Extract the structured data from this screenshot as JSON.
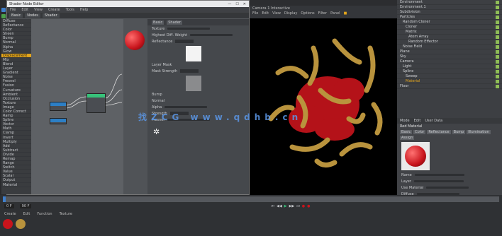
{
  "node_window": {
    "title": "Shader Node Editor",
    "menu": [
      "File",
      "Edit",
      "View",
      "Create",
      "Tools",
      "Help"
    ],
    "tabs": [
      "Basic",
      "Nodes",
      "Shader"
    ],
    "node_list": [
      "Diffuse",
      "Reflectance",
      "Color",
      "Sheen",
      "Bump",
      "Normal",
      "Alpha",
      "Glow",
      "Displacement",
      "Mix",
      "Blend",
      "Layer",
      "Gradient",
      "Noise",
      "Fresnel",
      "Fusion",
      "Curvature",
      "Ambient",
      "Occlusion",
      "Texture",
      "Image",
      "Color Correct",
      "Ramp",
      "Spline",
      "Vector",
      "Math",
      "Clamp",
      "Invert",
      "Multiply",
      "Add",
      "Subtract",
      "Divide",
      "Remap",
      "Range",
      "Switch",
      "Value",
      "Scalar",
      "Output",
      "Material"
    ],
    "attr_header": [
      "Basic",
      "Shader"
    ],
    "attr_rows": [
      "Texture",
      "Highest Diff. Weight",
      "Reflectance",
      "Layer Mask",
      "Mask Strength",
      "Bump",
      "Normal",
      "Alpha",
      "Strength",
      "Fresnel"
    ]
  },
  "viewport": {
    "title": "Camera 1 Interactive",
    "menu": [
      "File",
      "Edit",
      "View",
      "Display",
      "Options",
      "Filter",
      "Panel"
    ],
    "watermark": "找ZCG   www.qdhb.cn"
  },
  "object_manager": {
    "objects": [
      "Environment",
      "Environment.1",
      "Subdivision",
      "Particles",
      "Random Cloner",
      "Cloner",
      "Matrix",
      "Atom Array",
      "Random Effector",
      "Noise Field",
      "Plane",
      "Sky",
      "Camera",
      "Light",
      "Spline",
      "Sweep",
      "Material",
      "Floor"
    ]
  },
  "attribute_panel": {
    "tabs": [
      "Mode",
      "Edit",
      "User Data"
    ],
    "material_name": "Red Material",
    "sub_tabs": [
      "Basic",
      "Color",
      "Reflectance",
      "Bump",
      "Illumination",
      "Assign"
    ],
    "fields": [
      "Name",
      "Layer",
      "Use Material",
      "Diffuse",
      "Color"
    ]
  },
  "timeline": {
    "tabs": [
      "Create",
      "Edit",
      "Function",
      "Texture"
    ],
    "frame_start": "0 F",
    "frame_end": "90 F"
  },
  "colors": {
    "accent": "#e3a51c",
    "material_red": "#c8141c",
    "gold": "#b9933d",
    "node_green": "#37c27a",
    "node_blue": "#2d7fc5"
  }
}
